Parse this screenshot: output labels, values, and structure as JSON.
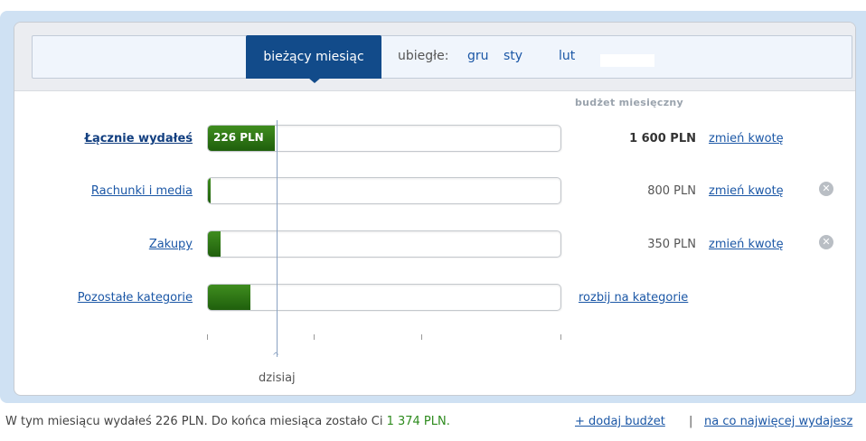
{
  "tabs": {
    "current": "bieżący miesiąc",
    "previous_label": "ubiegłe:",
    "previous_months": [
      "gru",
      "sty",
      "lut"
    ]
  },
  "column_header": "budżet miesięczny",
  "rows": [
    {
      "label": "Łącznie wydałeś",
      "fill_text": "226 PLN",
      "fill_fraction": 0.19,
      "amount": "1 600 PLN",
      "change_link": "zmień kwotę",
      "removable": false
    },
    {
      "label": "Rachunki i media",
      "fill_fraction": 0.005,
      "amount": "800 PLN",
      "change_link": "zmień kwotę",
      "removable": true
    },
    {
      "label": "Zakupy",
      "fill_fraction": 0.035,
      "amount": "350 PLN",
      "change_link": "zmień kwotę",
      "removable": true
    },
    {
      "label": "Pozostałe kategorie",
      "fill_fraction": 0.12,
      "split_link": "rozbij na kategorie"
    }
  ],
  "today_marker": {
    "label": "dzisiaj",
    "caret": "^"
  },
  "footer": {
    "summary_before": "W tym miesiącu wydałeś 226 PLN. Do końca miesiąca zostało Ci ",
    "summary_remaining": "1 374 PLN.",
    "add_budget_link": "+ dodaj budżet",
    "separator": "|",
    "most_spent_link": "na co najwięcej wydajesz"
  },
  "colors": {
    "accent": "#124b8a",
    "link": "#1b57a6",
    "bar_fill": "#2b7515",
    "remaining_text": "#2e8b1e"
  },
  "icons": {
    "remove": "close-circle-icon"
  }
}
